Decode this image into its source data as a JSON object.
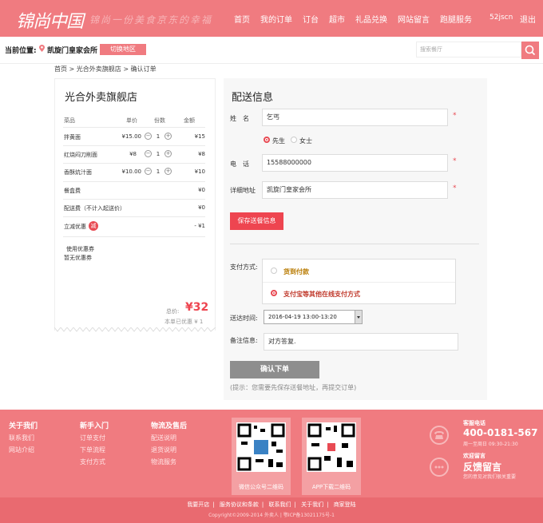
{
  "header": {
    "logo": "锦尚中国",
    "slogan": "锦尚一份美食京东的幸福",
    "nav": [
      "首页",
      "我的订单",
      "订台",
      "超市",
      "礼品兑换",
      "网站留言",
      "跑腿服务"
    ],
    "user": "52jscn",
    "logout": "退出",
    "accent": "#f07b80"
  },
  "location": {
    "label": "当前位置:",
    "name": "凯旋门皇家会所",
    "switch_label": "切换地区",
    "search_placeholder": "搜索餐厅"
  },
  "breadcrumb": "首页 > 光合外卖旗舰店 > 确认订单",
  "order": {
    "shop_name": "光合外卖旗舰店",
    "headers": {
      "name": "菜品",
      "price": "单价",
      "qty": "份数",
      "amount": "金额"
    },
    "items": [
      {
        "name": "拌黄面",
        "price": "¥15.00",
        "qty": "1",
        "amount": "¥15"
      },
      {
        "name": "红烧闷刀削面",
        "price": "¥8",
        "qty": "1",
        "amount": "¥8"
      },
      {
        "name": "香酥炕汁面",
        "price": "¥10.00",
        "qty": "1",
        "amount": "¥10"
      }
    ],
    "box_fee": {
      "name": "餐盒费",
      "amount": "¥0"
    },
    "delivery_fee": {
      "name": "配送费（不计入起送价）",
      "amount": "¥0"
    },
    "discount": {
      "name": "立减优惠",
      "badge": "减",
      "amount": "- ¥1"
    },
    "coupon_label": "使用优惠券",
    "coupon_none": "暂无优惠券",
    "total_label": "总价:",
    "total": "¥32",
    "saved": "本单已优惠 ¥ 1"
  },
  "form": {
    "title": "配送信息",
    "name_label": "姓　名",
    "name_value": "乞丐",
    "gender_male": "先生",
    "gender_female": "女士",
    "phone_label": "电　话",
    "phone_value": "15588000000",
    "address_label": "详细地址",
    "address_value": "凯旋门皇家会所",
    "required": "*",
    "save_label": "保存送餐信息",
    "pay_label": "支付方式:",
    "pay_cod": "货到付款",
    "pay_online": "支付宝等其他在线支付方式",
    "time_label": "送达时间:",
    "time_value": "2016-04-19 13:00-13:20",
    "note_label": "备注信息:",
    "note_value": "对方答复.",
    "confirm_label": "确认下单",
    "hint": "(提示：您需要先保存送餐地址，再提交订单)"
  },
  "footer": {
    "about": {
      "title": "关于我们",
      "items": [
        "联系我们",
        "网站介绍"
      ]
    },
    "guide": {
      "title": "新手入门",
      "items": [
        "订单支付",
        "下单流程",
        "支付方式"
      ]
    },
    "logistics": {
      "title": "物流及售后",
      "items": [
        "配送说明",
        "退货说明",
        "物流服务"
      ]
    },
    "qr_wechat": "微信公众号二维码",
    "qr_app": "APP下载二维码",
    "phone_title": "客服电话",
    "phone": "400-0181-567",
    "phone_hours": "周一至周日 09:30-21:30",
    "msg_title": "欢迎留言",
    "msg_big": "反馈留言",
    "msg_sub": "您的意见对我们很关重要",
    "links": [
      "我要开店",
      "服务协议和条款",
      "联系我们",
      "关于我们",
      "商家登陆"
    ],
    "copyright": "Copyright©2009-2014 外卖人 | 鄂ICP备13021175号-1"
  }
}
